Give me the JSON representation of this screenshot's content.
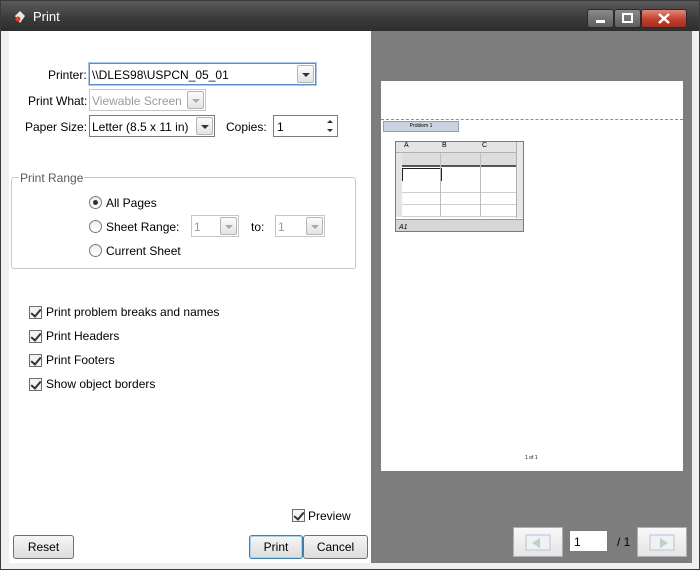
{
  "window": {
    "title": "Print"
  },
  "form": {
    "printer_label": "Printer:",
    "printer_value": "\\\\DLES98\\USPCN_05_01",
    "print_what_label": "Print What:",
    "print_what_value": "Viewable Screen",
    "paper_size_label": "Paper Size:",
    "paper_size_value": "Letter (8.5 x 11 in)",
    "copies_label": "Copies:",
    "copies_value": "1"
  },
  "print_range": {
    "title": "Print Range",
    "all_pages": "All Pages",
    "sheet_range": "Sheet Range:",
    "from_value": "1",
    "to_label": "to:",
    "to_value": "1",
    "current_sheet": "Current Sheet",
    "selected": "all_pages"
  },
  "options": [
    {
      "label": "Print problem breaks and names",
      "checked": true
    },
    {
      "label": "Print Headers",
      "checked": true
    },
    {
      "label": "Print Footers",
      "checked": true
    },
    {
      "label": "Show object borders",
      "checked": true
    }
  ],
  "preview": {
    "toggle_label": "Preview",
    "toggle_checked": true,
    "problem_tab": "Problem 1",
    "columns": [
      "A",
      "B",
      "C"
    ],
    "cell_ref": "A1",
    "page_footer": "1 of 1",
    "page_input": "1",
    "page_total": "/ 1"
  },
  "buttons": {
    "reset": "Reset",
    "print": "Print",
    "cancel": "Cancel"
  }
}
